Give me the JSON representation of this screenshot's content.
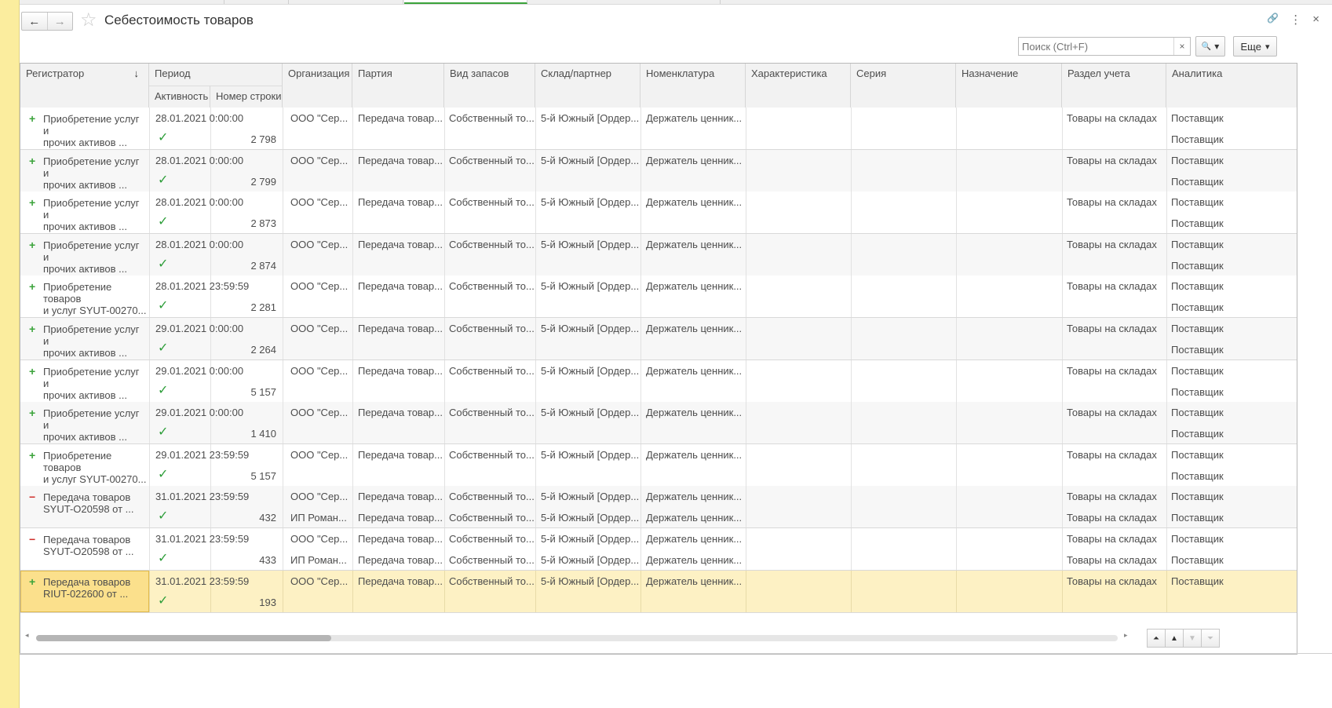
{
  "window": {
    "title": "Себестоимость товаров",
    "back_icon": "←",
    "forward_icon": "→",
    "favorite_icon": "☆",
    "link_icon": "🔗",
    "menu_icon": "⋮",
    "close_icon": "×"
  },
  "search": {
    "placeholder": "Поиск (Ctrl+F)",
    "clear_icon": "×",
    "search_icon": "🔍",
    "dropdown_icon": "▾"
  },
  "more_button": {
    "label": "Еще",
    "dropdown_icon": "▾"
  },
  "columns": {
    "registrar": "Регистратор",
    "sort_icon": "↓",
    "period": "Период",
    "active": "Активность",
    "line_no": "Номер строки",
    "org": "Организация",
    "batch": "Партия",
    "stock_type": "Вид запасов",
    "warehouse": "Склад/партнер",
    "nomenclature": "Номенклатура",
    "characteristic": "Характеристика",
    "series": "Серия",
    "purpose": "Назначение",
    "section": "Раздел учета",
    "analytics": "Аналитика"
  },
  "rows": [
    {
      "sign": "+",
      "reg1": "Приобретение услуг и",
      "reg2": "прочих активов ...",
      "period": "28.01.2021 0:00:00",
      "line": "2 798",
      "org": [
        "ООО \"Сер..."
      ],
      "batch": [
        "Передача товар..."
      ],
      "stock": [
        "Собственный то..."
      ],
      "wh": [
        "5-й Южный [Ордер..."
      ],
      "nom": [
        "Держатель ценник..."
      ],
      "section": [
        "Товары на складах"
      ],
      "anal": [
        "Поставщик",
        "Поставщик"
      ]
    },
    {
      "sign": "+",
      "reg1": "Приобретение услуг и",
      "reg2": "прочих активов ...",
      "period": "28.01.2021 0:00:00",
      "line": "2 799",
      "org": [
        "ООО \"Сер..."
      ],
      "batch": [
        "Передача товар..."
      ],
      "stock": [
        "Собственный то..."
      ],
      "wh": [
        "5-й Южный [Ордер..."
      ],
      "nom": [
        "Держатель ценник..."
      ],
      "section": [
        "Товары на складах"
      ],
      "anal": [
        "Поставщик",
        "Поставщик"
      ]
    },
    {
      "sign": "+",
      "reg1": "Приобретение услуг и",
      "reg2": "прочих активов ...",
      "period": "28.01.2021 0:00:00",
      "line": "2 873",
      "org": [
        "ООО \"Сер..."
      ],
      "batch": [
        "Передача товар..."
      ],
      "stock": [
        "Собственный то..."
      ],
      "wh": [
        "5-й Южный [Ордер..."
      ],
      "nom": [
        "Держатель ценник..."
      ],
      "section": [
        "Товары на складах"
      ],
      "anal": [
        "Поставщик",
        "Поставщик"
      ]
    },
    {
      "sign": "+",
      "reg1": "Приобретение услуг и",
      "reg2": "прочих активов ...",
      "period": "28.01.2021 0:00:00",
      "line": "2 874",
      "org": [
        "ООО \"Сер..."
      ],
      "batch": [
        "Передача товар..."
      ],
      "stock": [
        "Собственный то..."
      ],
      "wh": [
        "5-й Южный [Ордер..."
      ],
      "nom": [
        "Держатель ценник..."
      ],
      "section": [
        "Товары на складах"
      ],
      "anal": [
        "Поставщик",
        "Поставщик"
      ]
    },
    {
      "sign": "+",
      "reg1": "Приобретение товаров",
      "reg2": "и услуг SYUT-00270...",
      "period": "28.01.2021 23:59:59",
      "line": "2 281",
      "org": [
        "ООО \"Сер..."
      ],
      "batch": [
        "Передача товар..."
      ],
      "stock": [
        "Собственный то..."
      ],
      "wh": [
        "5-й Южный [Ордер..."
      ],
      "nom": [
        "Держатель ценник..."
      ],
      "section": [
        "Товары на складах"
      ],
      "anal": [
        "Поставщик",
        "Поставщик"
      ]
    },
    {
      "sign": "+",
      "reg1": "Приобретение услуг и",
      "reg2": "прочих активов ...",
      "period": "29.01.2021 0:00:00",
      "line": "2 264",
      "org": [
        "ООО \"Сер..."
      ],
      "batch": [
        "Передача товар..."
      ],
      "stock": [
        "Собственный то..."
      ],
      "wh": [
        "5-й Южный [Ордер..."
      ],
      "nom": [
        "Держатель ценник..."
      ],
      "section": [
        "Товары на складах"
      ],
      "anal": [
        "Поставщик",
        "Поставщик"
      ]
    },
    {
      "sign": "+",
      "reg1": "Приобретение услуг и",
      "reg2": "прочих активов ...",
      "period": "29.01.2021 0:00:00",
      "line": "5 157",
      "org": [
        "ООО \"Сер..."
      ],
      "batch": [
        "Передача товар..."
      ],
      "stock": [
        "Собственный то..."
      ],
      "wh": [
        "5-й Южный [Ордер..."
      ],
      "nom": [
        "Держатель ценник..."
      ],
      "section": [
        "Товары на складах"
      ],
      "anal": [
        "Поставщик",
        "Поставщик"
      ]
    },
    {
      "sign": "+",
      "reg1": "Приобретение услуг и",
      "reg2": "прочих активов ...",
      "period": "29.01.2021 0:00:00",
      "line": "1 410",
      "org": [
        "ООО \"Сер..."
      ],
      "batch": [
        "Передача товар..."
      ],
      "stock": [
        "Собственный то..."
      ],
      "wh": [
        "5-й Южный [Ордер..."
      ],
      "nom": [
        "Держатель ценник..."
      ],
      "section": [
        "Товары на складах"
      ],
      "anal": [
        "Поставщик",
        "Поставщик"
      ]
    },
    {
      "sign": "+",
      "reg1": "Приобретение товаров",
      "reg2": "и услуг SYUT-00270...",
      "period": "29.01.2021 23:59:59",
      "line": "5 157",
      "org": [
        "ООО \"Сер..."
      ],
      "batch": [
        "Передача товар..."
      ],
      "stock": [
        "Собственный то..."
      ],
      "wh": [
        "5-й Южный [Ордер..."
      ],
      "nom": [
        "Держатель ценник..."
      ],
      "section": [
        "Товары на складах"
      ],
      "anal": [
        "Поставщик",
        "Поставщик"
      ]
    },
    {
      "sign": "−",
      "reg1": "Передача товаров",
      "reg2": "SYUT-O20598 от ...",
      "period": "31.01.2021 23:59:59",
      "line": "432",
      "org": [
        "ООО \"Сер...",
        "ИП Роман..."
      ],
      "batch": [
        "Передача товар...",
        "Передача товар..."
      ],
      "stock": [
        "Собственный то...",
        "Собственный то..."
      ],
      "wh": [
        "5-й Южный [Ордер...",
        "5-й Южный [Ордер..."
      ],
      "nom": [
        "Держатель ценник...",
        "Держатель ценник..."
      ],
      "section": [
        "Товары на складах",
        "Товары на складах"
      ],
      "anal": [
        "Поставщик",
        "Поставщик"
      ]
    },
    {
      "sign": "−",
      "reg1": "Передача товаров",
      "reg2": "SYUT-O20598 от ...",
      "period": "31.01.2021 23:59:59",
      "line": "433",
      "org": [
        "ООО \"Сер...",
        "ИП Роман..."
      ],
      "batch": [
        "Передача товар...",
        "Передача товар..."
      ],
      "stock": [
        "Собственный то...",
        "Собственный то..."
      ],
      "wh": [
        "5-й Южный [Ордер...",
        "5-й Южный [Ордер..."
      ],
      "nom": [
        "Держатель ценник...",
        "Держатель ценник..."
      ],
      "section": [
        "Товары на складах",
        "Товары на складах"
      ],
      "anal": [
        "Поставщик",
        "Поставщик"
      ]
    },
    {
      "sign": "+",
      "reg1": "Передача товаров",
      "reg2": "RIUT-022600 от ...",
      "period": "31.01.2021 23:59:59",
      "line": "193",
      "org": [
        "ООО \"Сер..."
      ],
      "batch": [
        "Передача товар..."
      ],
      "stock": [
        "Собственный то..."
      ],
      "wh": [
        "5-й Южный [Ордер..."
      ],
      "nom": [
        "Держатель ценник..."
      ],
      "section": [
        "Товары на складах"
      ],
      "anal": [
        "Поставщик"
      ],
      "selected": true
    }
  ],
  "check_icon": "✓",
  "scroll": {
    "left_icon": "◂",
    "right_icon": "▸",
    "first_icon": "⏶",
    "up_icon": "▲",
    "down_icon": "▼",
    "last_icon": "⏷"
  },
  "colors": {
    "accent_green": "#3aa33a",
    "minus_red": "#d0312d",
    "selected_row": "#fdf1c4",
    "left_strip": "#fbed9e"
  }
}
